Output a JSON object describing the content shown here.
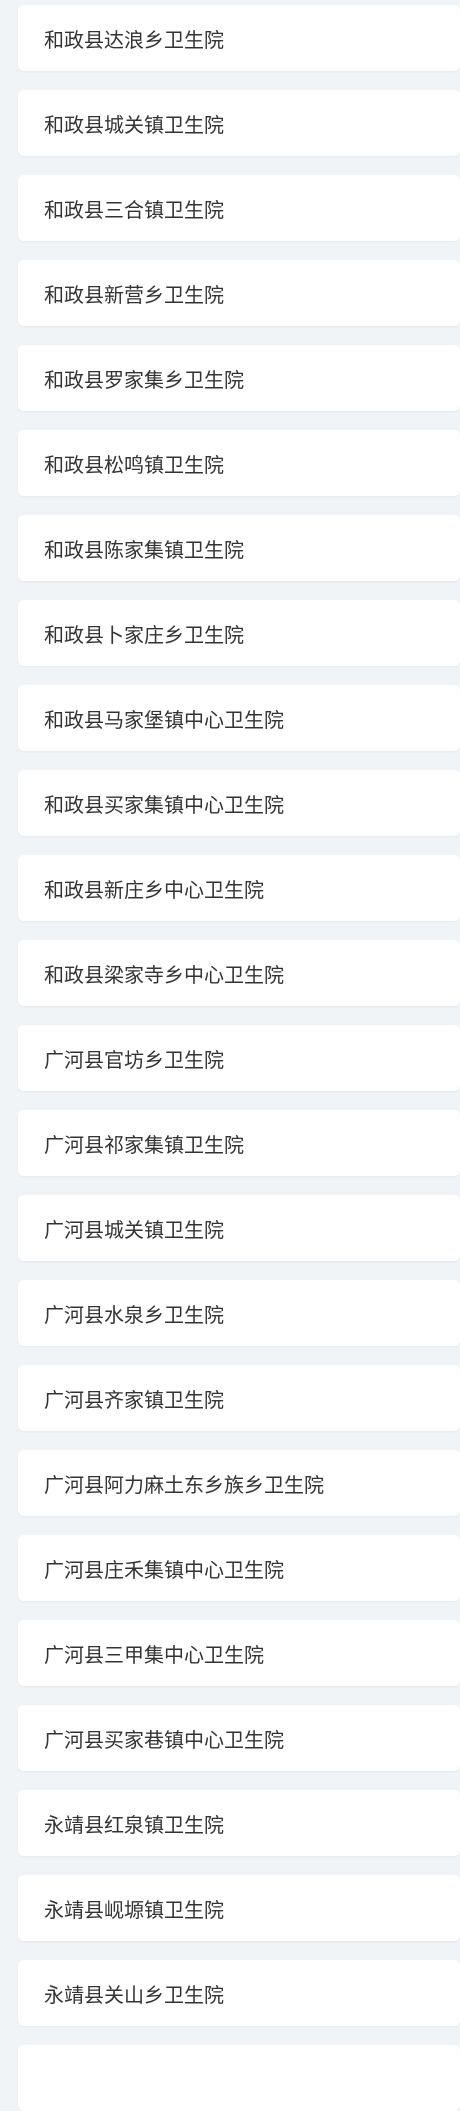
{
  "items": [
    "和政县达浪乡卫生院",
    "和政县城关镇卫生院",
    "和政县三合镇卫生院",
    "和政县新营乡卫生院",
    "和政县罗家集乡卫生院",
    "和政县松鸣镇卫生院",
    "和政县陈家集镇卫生院",
    "和政县卜家庄乡卫生院",
    "和政县马家堡镇中心卫生院",
    "和政县买家集镇中心卫生院",
    "和政县新庄乡中心卫生院",
    "和政县梁家寺乡中心卫生院",
    "广河县官坊乡卫生院",
    "广河县祁家集镇卫生院",
    "广河县城关镇卫生院",
    "广河县水泉乡卫生院",
    "广河县齐家镇卫生院",
    "广河县阿力麻土东乡族乡卫生院",
    "广河县庄禾集镇中心卫生院",
    "广河县三甲集中心卫生院",
    "广河县买家巷镇中心卫生院",
    "永靖县红泉镇卫生院",
    "永靖县岘塬镇卫生院",
    "永靖县关山乡卫生院",
    ""
  ]
}
